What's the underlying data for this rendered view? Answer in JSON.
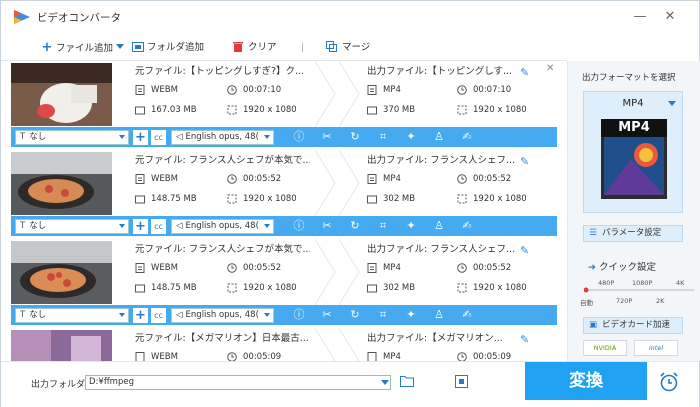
{
  "window": {
    "title": "ビデオコンバータ",
    "minimize": "—",
    "close": "✕"
  },
  "toolbar": {
    "add_file": "ファイル追加",
    "add_folder": "フォルダ追加",
    "clear": "クリア",
    "merge": "マージ"
  },
  "items": [
    {
      "src_name": "元ファイル:【トッピングしすぎ?】ク...",
      "src_format": "WEBM",
      "src_duration": "00:07:10",
      "src_size": "167.03 MB",
      "src_res": "1920 x 1080",
      "out_name": "出力ファイル:【トッピングしす...",
      "out_format": "MP4",
      "out_duration": "00:07:10",
      "out_size": "370 MB",
      "out_res": "1920 x 1080",
      "subtitle": "なし",
      "audio": "English opus, 48("
    },
    {
      "src_name": "元ファイル: フランス人シェフが本気で...",
      "src_format": "WEBM",
      "src_duration": "00:05:52",
      "src_size": "148.75 MB",
      "src_res": "1920 x 1080",
      "out_name": "出力ファイル: フランス人シェフ...",
      "out_format": "MP4",
      "out_duration": "00:05:52",
      "out_size": "302 MB",
      "out_res": "1920 x 1080",
      "subtitle": "なし",
      "audio": "English opus, 48("
    },
    {
      "src_name": "元ファイル: フランス人シェフが本気で...",
      "src_format": "WEBM",
      "src_duration": "00:05:52",
      "src_size": "148.75 MB",
      "src_res": "1920 x 1080",
      "out_name": "出力ファイル: フランス人シェフ...",
      "out_format": "MP4",
      "out_duration": "00:05:52",
      "out_size": "302 MB",
      "out_res": "1920 x 1080",
      "subtitle": "なし",
      "audio": "English opus, 48("
    },
    {
      "src_name": "元ファイル:【メガマリオン】日本最古...",
      "src_format": "WEBM",
      "src_duration": "00:05:09",
      "src_size": "",
      "src_res": "",
      "out_name": "出力ファイル:【メガマリオン...",
      "out_format": "MP4",
      "out_duration": "00:05:09",
      "out_size": "",
      "out_res": "",
      "subtitle": "",
      "audio": ""
    }
  ],
  "right_panel": {
    "output_format_title": "出力フォーマットを選択",
    "format": "MP4",
    "format_badge": "MP4",
    "parameter_settings": "パラメータ設定",
    "quick_settings": "クイック設定",
    "slider_top": [
      "480P",
      "1080P",
      "4K"
    ],
    "slider_bottom": [
      "自動",
      "720P",
      "2K"
    ],
    "gpu_accel": "ビデオカード加速",
    "nvidia": "NVIDIA",
    "intel": "intel"
  },
  "bottom": {
    "output_folder_label": "出力フォルダ:",
    "output_folder_path": "D:¥ffmpeg",
    "convert": "変換"
  },
  "colors": {
    "accent": "#45aaf0",
    "convert": "#1fa2f2",
    "panel": "#deeefa"
  }
}
